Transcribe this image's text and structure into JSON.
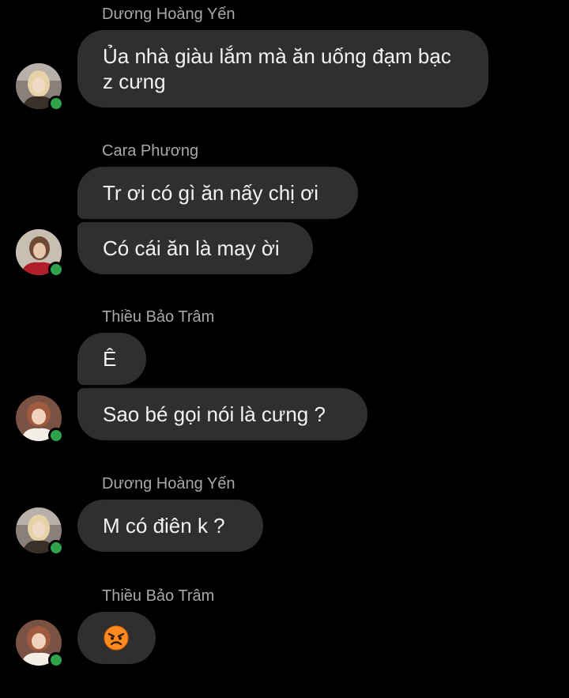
{
  "colors": {
    "background": "#000000",
    "bubble": "#2f2f2f",
    "bubble_text": "#f2f2f2",
    "sender_name": "#a8a8a8",
    "online": "#31a24c"
  },
  "messages": [
    {
      "sender": "Dương Hoàng Yến",
      "avatar_icon": "user-avatar-duong-hoang-yen",
      "bubbles": [
        "Ủa nhà giàu lắm mà ăn uống đạm bạc z cưng"
      ]
    },
    {
      "sender": "Cara Phương",
      "avatar_icon": "user-avatar-cara-phuong",
      "bubbles": [
        "Tr ơi có gì ăn nấy chị ơi",
        "Có cái ăn là may ời"
      ]
    },
    {
      "sender": "Thiều Bảo Trâm",
      "avatar_icon": "user-avatar-thieu-bao-tram",
      "bubbles": [
        "Ê",
        "Sao bé gọi nói là cưng ?"
      ]
    },
    {
      "sender": "Dương Hoàng Yến",
      "avatar_icon": "user-avatar-duong-hoang-yen",
      "bubbles": [
        "M có điên k ?"
      ]
    },
    {
      "sender": "Thiều Bảo Trâm",
      "avatar_icon": "user-avatar-thieu-bao-tram",
      "bubbles": [
        "angry-face-emoji"
      ]
    }
  ]
}
